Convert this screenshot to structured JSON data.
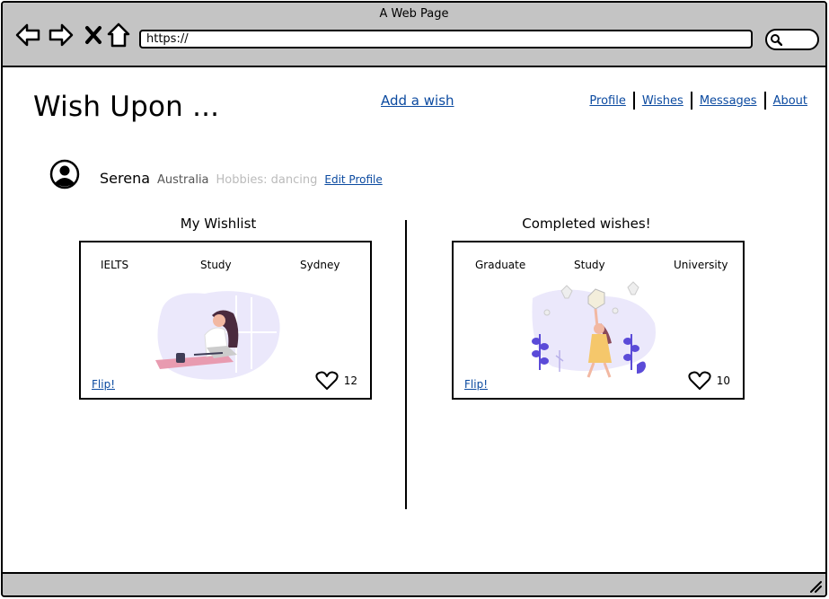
{
  "window": {
    "title": "A Web Page",
    "url": "https://"
  },
  "site": {
    "logo": "Wish Upon ...",
    "add_wish": "Add a wish"
  },
  "nav": {
    "items": [
      "Profile",
      "Wishes",
      "Messages",
      "About"
    ]
  },
  "profile": {
    "name": "Serena",
    "country": "Australia",
    "hobbies": "Hobbies: dancing",
    "edit_label": "Edit Profile"
  },
  "wishlist": {
    "title": "My Wishlist",
    "card": {
      "tags": [
        "IELTS",
        "Study",
        "Sydney"
      ],
      "flip_label": "Flip!",
      "likes": "12",
      "illustration": "woman-studying-at-desk"
    }
  },
  "completed": {
    "title": "Completed wishes!",
    "card": {
      "tags": [
        "Graduate",
        "Study",
        "University"
      ],
      "flip_label": "Flip!",
      "likes": "10",
      "illustration": "woman-with-lanterns"
    }
  },
  "icons": [
    "back-arrow-icon",
    "forward-arrow-icon",
    "close-x-icon",
    "home-icon",
    "search-icon",
    "user-avatar-icon",
    "heart-icon",
    "resize-handle-icon"
  ],
  "colors": {
    "link": "#0b4aa0",
    "chrome": "#c4c4c4",
    "illustration_purple": "#5b4bd8",
    "illustration_pink": "#e89bb0"
  }
}
